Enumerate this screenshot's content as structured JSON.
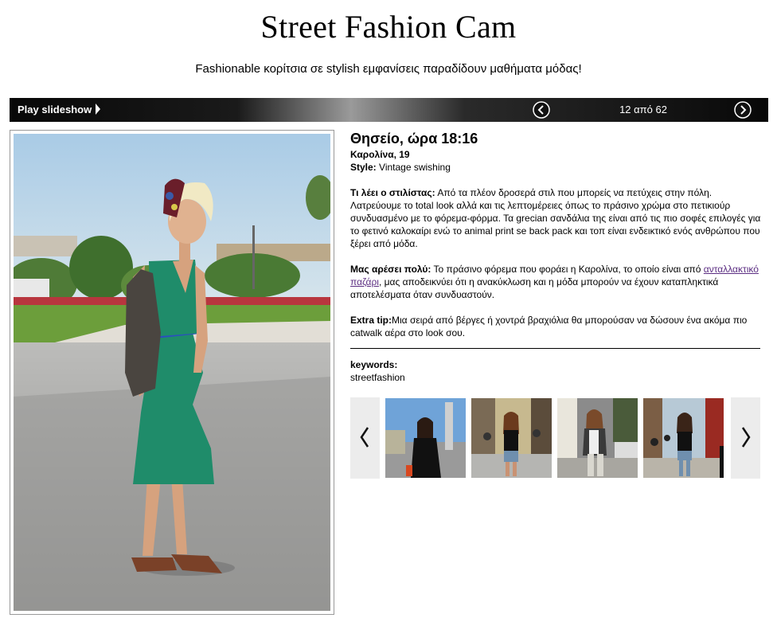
{
  "header": {
    "title": "Street Fashion Cam",
    "subtitle": "Fashionable κορίτσια σε stylish εμφανίσεις παραδίδουν μαθήματα μόδας!"
  },
  "toolbar": {
    "play_label": "Play slideshow",
    "counter": "12 από 62"
  },
  "article": {
    "location": "Θησείο, ώρα 18:16",
    "name_age": "Καρολίνα, 19",
    "style_label": "Style:",
    "style_value": "Vintage swishing",
    "stylist_label": "Τι λέει ο στιλίστας:",
    "stylist_text": "Από τα πλέον δροσερά στιλ που μπορείς να πετύχεις στην πόλη. Λατρεύουμε το total look αλλά και τις λεπτομέρειες όπως το πράσινο χρώμα στο πετικιούρ συνδυασμένο με το φόρεμα-φόρμα. Τα grecian σανδάλια της είναι από τις πιο σοφές επιλογές για το φετινό καλοκαίρι ενώ το animal print se back pack και τοπ είναι ενδεικτικό ενός ανθρώπου που ξέρει από μόδα.",
    "like_label": "Μας αρέσει πολύ:",
    "like_text_before": "Το πράσινο φόρεμα που φοράει η Καρολίνα, το οποίο είναι από",
    "like_link": "ανταλλακτικό παζάρι",
    "like_text_after": ", μας αποδεικνύει ότι η ανακύκλωση και η μόδα μπορούν να έχουν καταπληκτικά αποτελέσματα όταν συνδυαστούν.",
    "extra_label": "Extra tip:",
    "extra_text": "Μια σειρά από βέργες ή χοντρά βραχιόλια θα μπορούσαν να δώσουν ένα ακόμα πιο catwalk αέρα στο look σου."
  },
  "keywords": {
    "label": "keywords:",
    "value": "streetfashion"
  },
  "thumbnails": {
    "count": 4
  },
  "colors": {
    "dress": "#1f8c6a",
    "link": "#5b2d82"
  }
}
